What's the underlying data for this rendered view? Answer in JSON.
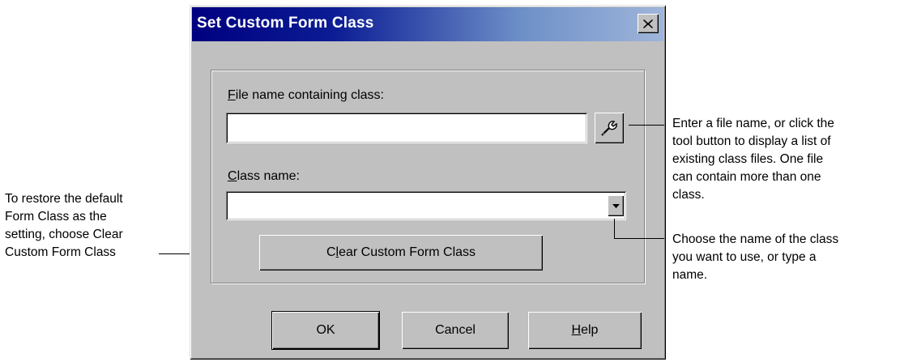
{
  "window": {
    "title": "Set Custom Form Class",
    "close_label": "Close"
  },
  "form": {
    "file_label_mnemonic": "F",
    "file_label_rest": "ile name containing class:",
    "file_value": "",
    "class_label_mnemonic": "C",
    "class_label_rest": "lass name:",
    "class_value": "",
    "clear_button_pre": "C",
    "clear_button_mnemonic": "l",
    "clear_button_post": "ear Custom Form Class"
  },
  "buttons": {
    "ok": "OK",
    "cancel": "Cancel",
    "help_mnemonic": "H",
    "help_rest": "elp"
  },
  "annotations": {
    "tool_button": "Enter a file name, or click the\ntool button to display a list of\nexisting class files. One file\ncan contain more than one\nclass.",
    "class_dropdown": "Choose the name of the class\nyou want to use, or type a\nname.",
    "clear_button": "To restore the default\nForm Class as the\nsetting, choose Clear\nCustom Form Class"
  },
  "icons": {
    "tool_button": "wrench-icon",
    "dropdown": "chevron-down-icon",
    "close": "close-icon"
  },
  "colors": {
    "titlebar_start": "#000080",
    "titlebar_end": "#9fb5da",
    "face": "#c0c0c0"
  }
}
